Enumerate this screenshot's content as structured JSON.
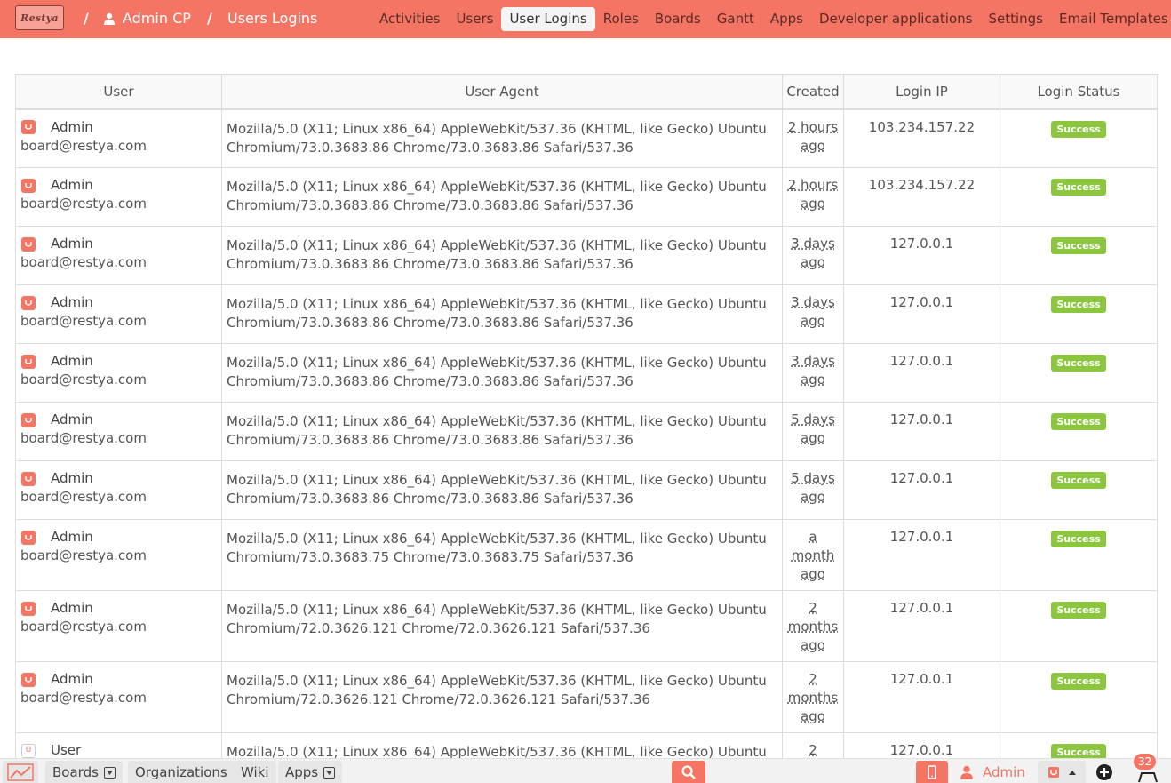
{
  "header": {
    "logo_text": "Restya",
    "breadcrumb": [
      {
        "label": "Admin CP",
        "icon": "user-icon"
      },
      {
        "label": "Users Logins"
      }
    ],
    "separator": "/",
    "nav": [
      {
        "label": "Activities",
        "active": false
      },
      {
        "label": "Users",
        "active": false
      },
      {
        "label": "User Logins",
        "active": true
      },
      {
        "label": "Roles",
        "active": false
      },
      {
        "label": "Boards",
        "active": false
      },
      {
        "label": "Gantt",
        "active": false
      },
      {
        "label": "Apps",
        "active": false
      },
      {
        "label": "Developer applications",
        "active": false
      },
      {
        "label": "Settings",
        "active": false
      },
      {
        "label": "Email Templates",
        "active": false
      }
    ]
  },
  "table": {
    "columns": [
      "User",
      "User Agent",
      "Created",
      "Login IP",
      "Login Status"
    ],
    "rows": [
      {
        "name": "Admin",
        "email": "board@restya.com",
        "ua1": "Mozilla/5.0 (X11; Linux x86_64) AppleWebKit/537.36 (KHTML, like Gecko) Ubuntu",
        "ua2": "Chromium/73.0.3683.86 Chrome/73.0.3683.86 Safari/537.36",
        "created": [
          "2 hours",
          "ago"
        ],
        "ip": "103.234.157.22",
        "status": "Success"
      },
      {
        "name": "Admin",
        "email": "board@restya.com",
        "ua1": "Mozilla/5.0 (X11; Linux x86_64) AppleWebKit/537.36 (KHTML, like Gecko) Ubuntu",
        "ua2": "Chromium/73.0.3683.86 Chrome/73.0.3683.86 Safari/537.36",
        "created": [
          "2 hours",
          "ago"
        ],
        "ip": "103.234.157.22",
        "status": "Success"
      },
      {
        "name": "Admin",
        "email": "board@restya.com",
        "ua1": "Mozilla/5.0 (X11; Linux x86_64) AppleWebKit/537.36 (KHTML, like Gecko) Ubuntu",
        "ua2": "Chromium/73.0.3683.86 Chrome/73.0.3683.86 Safari/537.36",
        "created": [
          "3 days",
          "ago"
        ],
        "ip": "127.0.0.1",
        "status": "Success"
      },
      {
        "name": "Admin",
        "email": "board@restya.com",
        "ua1": "Mozilla/5.0 (X11; Linux x86_64) AppleWebKit/537.36 (KHTML, like Gecko) Ubuntu",
        "ua2": "Chromium/73.0.3683.86 Chrome/73.0.3683.86 Safari/537.36",
        "created": [
          "3 days",
          "ago"
        ],
        "ip": "127.0.0.1",
        "status": "Success"
      },
      {
        "name": "Admin",
        "email": "board@restya.com",
        "ua1": "Mozilla/5.0 (X11; Linux x86_64) AppleWebKit/537.36 (KHTML, like Gecko) Ubuntu",
        "ua2": "Chromium/73.0.3683.86 Chrome/73.0.3683.86 Safari/537.36",
        "created": [
          "3 days",
          "ago"
        ],
        "ip": "127.0.0.1",
        "status": "Success"
      },
      {
        "name": "Admin",
        "email": "board@restya.com",
        "ua1": "Mozilla/5.0 (X11; Linux x86_64) AppleWebKit/537.36 (KHTML, like Gecko) Ubuntu",
        "ua2": "Chromium/73.0.3683.86 Chrome/73.0.3683.86 Safari/537.36",
        "created": [
          "5 days",
          "ago"
        ],
        "ip": "127.0.0.1",
        "status": "Success"
      },
      {
        "name": "Admin",
        "email": "board@restya.com",
        "ua1": "Mozilla/5.0 (X11; Linux x86_64) AppleWebKit/537.36 (KHTML, like Gecko) Ubuntu",
        "ua2": "Chromium/73.0.3683.86 Chrome/73.0.3683.86 Safari/537.36",
        "created": [
          "5 days",
          "ago"
        ],
        "ip": "127.0.0.1",
        "status": "Success"
      },
      {
        "name": "Admin",
        "email": "board@restya.com",
        "ua1": "Mozilla/5.0 (X11; Linux x86_64) AppleWebKit/537.36 (KHTML, like Gecko) Ubuntu",
        "ua2": "Chromium/73.0.3683.75 Chrome/73.0.3683.75 Safari/537.36",
        "created": [
          "a",
          "month",
          "ago"
        ],
        "ip": "127.0.0.1",
        "status": "Success"
      },
      {
        "name": "Admin",
        "email": "board@restya.com",
        "ua1": "Mozilla/5.0 (X11; Linux x86_64) AppleWebKit/537.36 (KHTML, like Gecko) Ubuntu",
        "ua2": "Chromium/72.0.3626.121 Chrome/72.0.3626.121 Safari/537.36",
        "created": [
          "2",
          "months",
          "ago"
        ],
        "ip": "127.0.0.1",
        "status": "Success"
      },
      {
        "name": "Admin",
        "email": "board@restya.com",
        "ua1": "Mozilla/5.0 (X11; Linux x86_64) AppleWebKit/537.36 (KHTML, like Gecko) Ubuntu",
        "ua2": "Chromium/72.0.3626.121 Chrome/72.0.3626.121 Safari/537.36",
        "created": [
          "2",
          "months",
          "ago"
        ],
        "ip": "127.0.0.1",
        "status": "Success"
      },
      {
        "name": "User",
        "email": "",
        "avatar_initial": "U",
        "ua1": "Mozilla/5.0 (X11; Linux x86_64) AppleWebKit/537.36 (KHTML, like Gecko) Ubuntu",
        "ua2": "",
        "created": [
          "2"
        ],
        "ip": "127.0.0.1",
        "status": "Success"
      }
    ]
  },
  "footer": {
    "boards_label": "Boards",
    "organizations_label": "Organizations",
    "wiki_label": "Wiki",
    "apps_label": "Apps",
    "user_label": "Admin",
    "notification_count": "32"
  },
  "colors": {
    "brand": "#f47564",
    "success": "#8cc63e"
  }
}
